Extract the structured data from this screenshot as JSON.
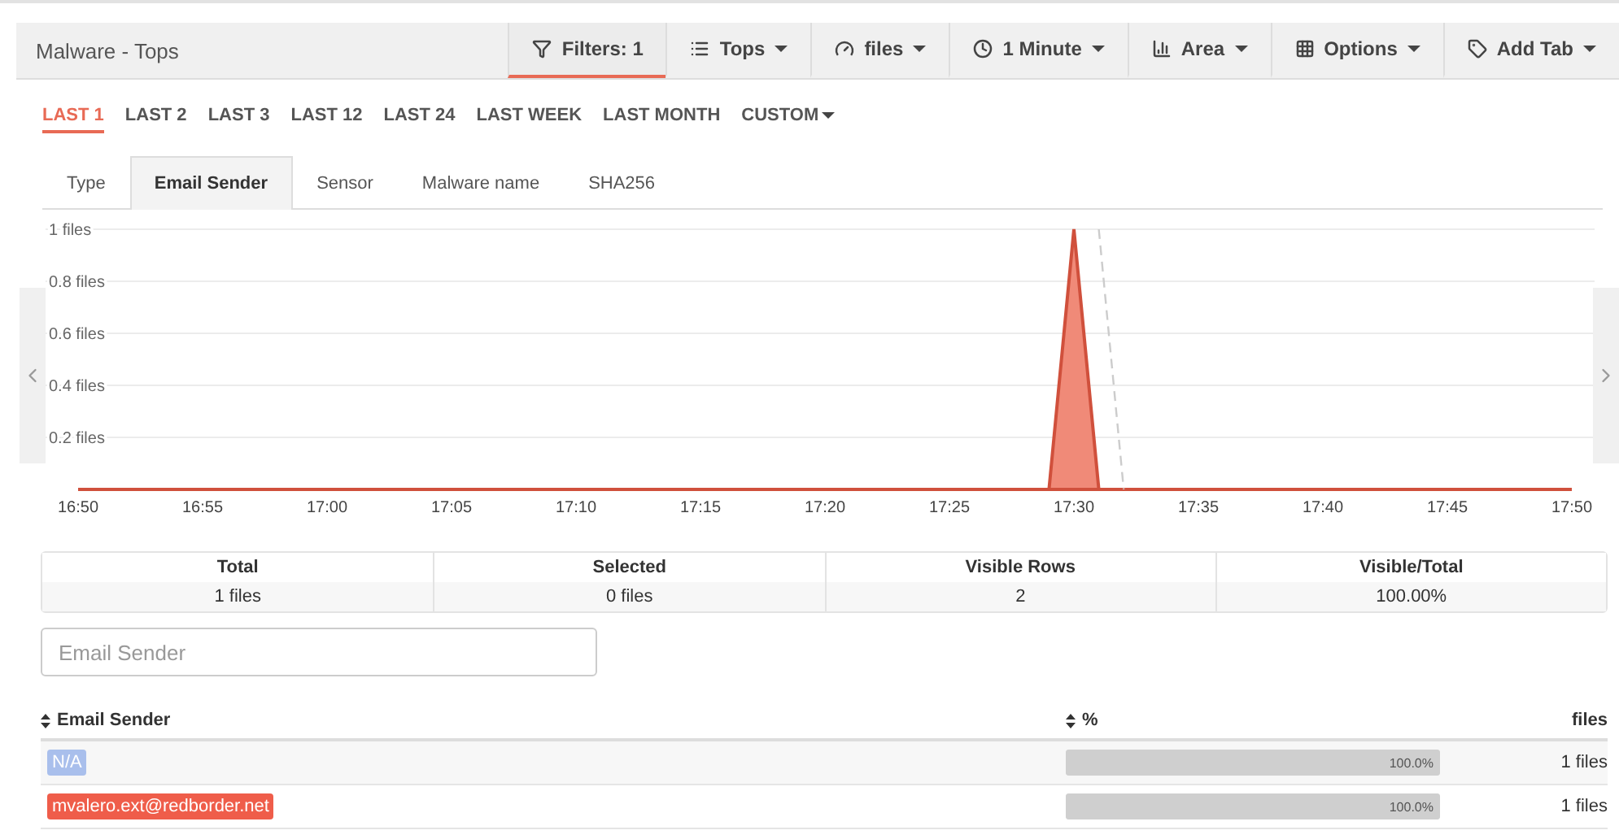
{
  "header": {
    "title": "Malware - Tops",
    "buttons": [
      {
        "label": "Filters: 1",
        "kind": "filter",
        "caret": false,
        "selected": true
      },
      {
        "label": "Tops",
        "kind": "list",
        "caret": true,
        "selected": false
      },
      {
        "label": "files",
        "kind": "gauge",
        "caret": true,
        "selected": false
      },
      {
        "label": "1 Minute",
        "kind": "clock",
        "caret": true,
        "selected": false
      },
      {
        "label": "Area",
        "kind": "chart",
        "caret": true,
        "selected": false
      },
      {
        "label": "Options",
        "kind": "grid",
        "caret": true,
        "selected": false
      },
      {
        "label": "Add Tab",
        "kind": "tag",
        "caret": true,
        "selected": false
      }
    ]
  },
  "ranges": [
    {
      "label": "LAST 1",
      "selected": true
    },
    {
      "label": "LAST 2",
      "selected": false
    },
    {
      "label": "LAST 3",
      "selected": false
    },
    {
      "label": "LAST 12",
      "selected": false
    },
    {
      "label": "LAST 24",
      "selected": false
    },
    {
      "label": "LAST WEEK",
      "selected": false
    },
    {
      "label": "LAST MONTH",
      "selected": false
    },
    {
      "label": "CUSTOM",
      "selected": false,
      "caret": true
    }
  ],
  "tabs": [
    {
      "label": "Type",
      "selected": false
    },
    {
      "label": "Email Sender",
      "selected": true
    },
    {
      "label": "Sensor",
      "selected": false
    },
    {
      "label": "Malware name",
      "selected": false
    },
    {
      "label": "SHA256",
      "selected": false
    }
  ],
  "chart_data": {
    "type": "area",
    "categories": [
      "16:50",
      null,
      null,
      null,
      null,
      "16:55",
      null,
      null,
      null,
      null,
      "17:00",
      null,
      null,
      null,
      null,
      "17:05",
      null,
      null,
      null,
      null,
      "17:10",
      null,
      null,
      null,
      null,
      "17:15",
      null,
      null,
      null,
      null,
      "17:20",
      null,
      null,
      null,
      null,
      "17:25",
      null,
      null,
      null,
      null,
      "17:30",
      null,
      null,
      null,
      null,
      "17:35",
      null,
      null,
      null,
      null,
      "17:40",
      null,
      null,
      null,
      null,
      "17:45",
      null,
      null,
      null,
      null,
      "17:50"
    ],
    "series": [
      {
        "color": "#f08a78",
        "values": [
          0,
          0,
          0,
          0,
          0,
          0,
          0,
          0,
          0,
          0,
          0,
          0,
          0,
          0,
          0,
          0,
          0,
          0,
          0,
          0,
          0,
          0,
          0,
          0,
          0,
          0,
          0,
          0,
          0,
          0,
          0,
          0,
          0,
          0,
          0,
          0,
          0,
          0,
          0,
          0,
          1,
          0,
          0,
          0,
          0,
          0,
          0,
          0,
          0,
          0,
          0,
          0,
          0,
          0,
          0,
          0,
          0,
          0,
          0,
          0,
          0
        ]
      },
      {
        "color": "#cccccc",
        "type": "line",
        "line_style": "dashed",
        "values": [
          null,
          null,
          null,
          null,
          null,
          null,
          null,
          null,
          null,
          null,
          null,
          null,
          null,
          null,
          null,
          null,
          null,
          null,
          null,
          null,
          null,
          null,
          null,
          null,
          null,
          null,
          null,
          null,
          null,
          null,
          null,
          null,
          null,
          null,
          null,
          null,
          null,
          null,
          null,
          null,
          null,
          1,
          0,
          null,
          null,
          null,
          null,
          null,
          null,
          null,
          null,
          null,
          null,
          null,
          null,
          null,
          null,
          null,
          null,
          null,
          null
        ]
      }
    ],
    "grid": true,
    "ylim": [
      0,
      1
    ],
    "yticks": [
      {
        "value": 0.2,
        "label": "0.2 files"
      },
      {
        "value": 0.4,
        "label": "0.4 files"
      },
      {
        "value": 0.6,
        "label": "0.6 files"
      },
      {
        "value": 0.8,
        "label": "0.8 files"
      },
      {
        "value": 1,
        "label": "1 files"
      }
    ]
  },
  "summary": [
    {
      "label": "Total",
      "value": "1 files"
    },
    {
      "label": "Selected",
      "value": "0 files"
    },
    {
      "label": "Visible Rows",
      "value": "2"
    },
    {
      "label": "Visible/Total",
      "value": "100.00%"
    }
  ],
  "search": {
    "placeholder": "Email Sender"
  },
  "table": {
    "columns": [
      "Email Sender",
      "%",
      "files"
    ],
    "rows": [
      {
        "sender": "N/A",
        "color": "#a9bfec",
        "level": 1,
        "percent": "100.0%",
        "files": "1 files"
      },
      {
        "sender": "mvalero.ext@redborder.net",
        "color": "#ef5d4a",
        "level": 1,
        "percent": "100.0%",
        "files": "1 files"
      }
    ]
  }
}
